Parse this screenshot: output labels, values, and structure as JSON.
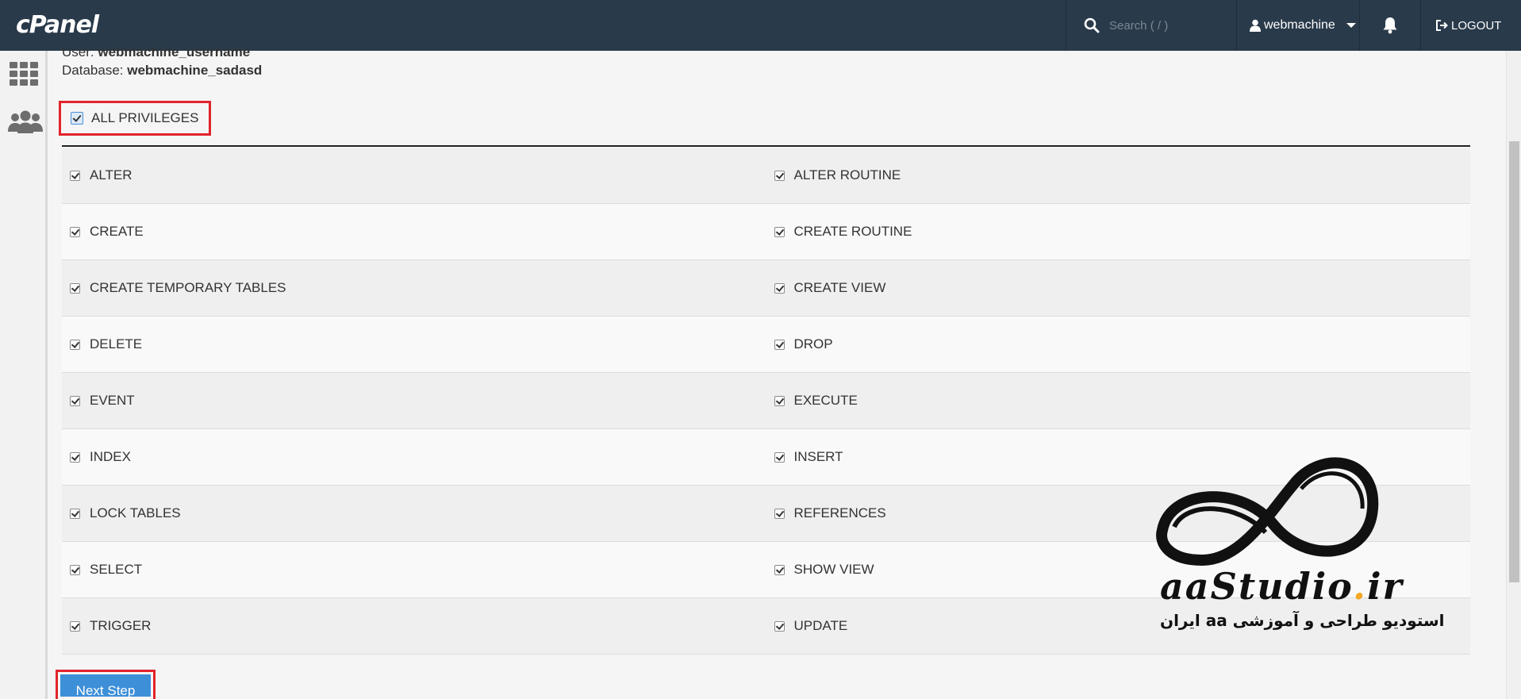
{
  "header": {
    "logo": "cPanel",
    "search_placeholder": "Search ( / )",
    "username": "webmachine",
    "logout_label": "LOGOUT"
  },
  "info": {
    "user_prefix": "User:",
    "user_value": "webmachine_username",
    "db_prefix": "Database:",
    "db_value": "webmachine_sadasd"
  },
  "all_privileges": {
    "label": "ALL PRIVILEGES",
    "checked": true
  },
  "privileges": {
    "rows": [
      {
        "left": "ALTER",
        "right": "ALTER ROUTINE"
      },
      {
        "left": "CREATE",
        "right": "CREATE ROUTINE"
      },
      {
        "left": "CREATE TEMPORARY TABLES",
        "right": "CREATE VIEW"
      },
      {
        "left": "DELETE",
        "right": "DROP"
      },
      {
        "left": "EVENT",
        "right": "EXECUTE"
      },
      {
        "left": "INDEX",
        "right": "INSERT"
      },
      {
        "left": "LOCK TABLES",
        "right": "REFERENCES"
      },
      {
        "left": "SELECT",
        "right": "SHOW VIEW"
      },
      {
        "left": "TRIGGER",
        "right": "UPDATE"
      }
    ]
  },
  "next_step_label": "Next Step",
  "watermark": {
    "en_main": "aaStudio",
    "en_dot": ".",
    "en_tld": "ir",
    "fa": "استودیو طراحی و آموزشی aa ایران"
  },
  "colors": {
    "topbar": "#293a4a",
    "highlight_border": "#e2232b",
    "primary_button": "#3d8fd8"
  }
}
